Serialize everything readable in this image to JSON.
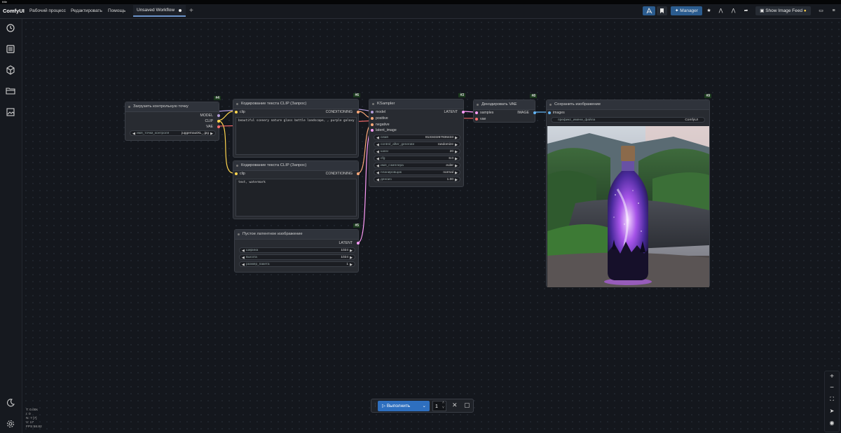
{
  "os": {
    "title": "title"
  },
  "header": {
    "logo": "ComfyUI",
    "menu": [
      "Рабочий процесс",
      "Редактировать",
      "Помощь"
    ],
    "workflow_tab": "Unsaved Workflow",
    "manager_label": "Manager",
    "feed_label": "Show Image Feed",
    "accent": "#2b5c8f"
  },
  "sidebar": {
    "icons": [
      "history-icon",
      "queue-icon",
      "node-library-icon",
      "workflows-icon",
      "image-gallery-icon"
    ],
    "bottom_icons": [
      "theme-moon-icon",
      "settings-gear-icon"
    ]
  },
  "nodes": {
    "checkpoint": {
      "id": "#4",
      "title": "Загрузить контрольную точку",
      "outputs": [
        "MODEL",
        "CLIP",
        "VAE"
      ],
      "widget_label": "имя_точки_контроля",
      "widget_value": "juggernautXL_.jpg"
    },
    "clip_pos": {
      "id": "#6",
      "title": "Кодирование текста CLIP (Запрос)",
      "input": "clip",
      "output": "CONDITIONING",
      "text": "beautiful scenery nature glass bottle landscape, , purple galaxy bottle,"
    },
    "clip_neg": {
      "id": "#7",
      "title": "Кодирование текста CLIP (Запрос)",
      "input": "clip",
      "output": "CONDITIONING",
      "text": "text, watermark"
    },
    "latent": {
      "id": "#5",
      "title": "Пустое латентное изображение",
      "output": "LATENT",
      "widgets": [
        {
          "label": "ширина",
          "value": "1024"
        },
        {
          "label": "высота",
          "value": "1024"
        },
        {
          "label": "размер_пакета",
          "value": "1"
        }
      ]
    },
    "ksampler": {
      "id": "#3",
      "title": "KSampler",
      "inputs": [
        "model",
        "positive",
        "negative",
        "latent_image"
      ],
      "output": "LATENT",
      "widgets": [
        {
          "label": "семя",
          "value": "813343267936433"
        },
        {
          "label": "control_after_generate",
          "value": "randomize"
        },
        {
          "label": "шаги",
          "value": "20"
        },
        {
          "label": "cfg",
          "value": "8.0"
        },
        {
          "label": "имя_сэмплера",
          "value": "euler"
        },
        {
          "label": "планировщик",
          "value": "normal"
        },
        {
          "label": "деноиз",
          "value": "1.00"
        }
      ]
    },
    "vae_decode": {
      "id": "#8",
      "title": "Декодировать VAE",
      "inputs": [
        "samples",
        "vae"
      ],
      "output": "IMAGE"
    },
    "save_image": {
      "id": "#9",
      "title": "Сохранить изображение",
      "input": "images",
      "widget_label": "префикс_имени_файла",
      "widget_value": "ComfyUI"
    }
  },
  "run_bar": {
    "run_label": "Выполнить",
    "batch_count": "1"
  },
  "stats": [
    "T: 0.00s",
    "I: 0",
    "N: 7 [7]",
    "V: 17",
    "FPS:58.82"
  ],
  "colors": {
    "model_wire": "#b39ddb",
    "clip_wire": "#ffd54f",
    "vae_wire": "#ff6e6e",
    "conditioning_wire": "#ffa97a",
    "latent_wire": "#ff9cf9",
    "image_wire": "#64b5f6"
  }
}
